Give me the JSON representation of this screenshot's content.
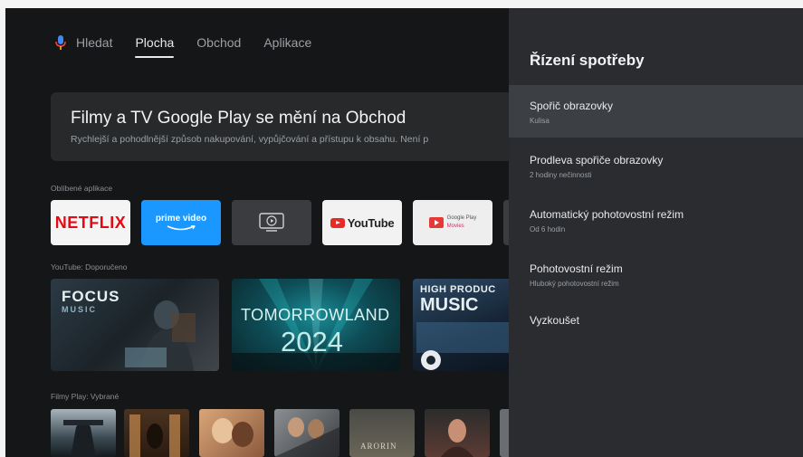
{
  "nav": {
    "search_label": "Hledat",
    "tabs": [
      {
        "label": "Plocha",
        "active": true
      },
      {
        "label": "Obchod",
        "active": false
      },
      {
        "label": "Aplikace",
        "active": false
      }
    ]
  },
  "banner": {
    "title": "Filmy a TV Google Play se mění na Obchod",
    "subtitle": "Rychlejší a pohodlnější způsob nakupování, vypůjčování a přístupu k obsahu. Není p"
  },
  "favorite_apps": {
    "label": "Oblíbené aplikace",
    "apps": [
      {
        "name": "Netflix",
        "text": "NETFLIX",
        "color": "#e50914"
      },
      {
        "name": "Prime Video",
        "text": "prime video",
        "color": "#1a98ff"
      },
      {
        "name": "Live TV",
        "icon": "tv-play-icon"
      },
      {
        "name": "YouTube",
        "text": "YouTube",
        "color": "#e52d27"
      },
      {
        "name": "Google Play Movies",
        "text_line1": "Google Play",
        "text_line2": "Movies",
        "color": "#e91e63"
      }
    ]
  },
  "youtube_recommended": {
    "label": "YouTube: Doporučeno",
    "videos": [
      {
        "title_line1": "FOCUS",
        "title_line2": "MUSIC"
      },
      {
        "title_line1": "TOMORROWLAND",
        "title_line2": "2024"
      },
      {
        "title_line1": "HIGH PRODUC",
        "title_line2": "MUSIC"
      }
    ]
  },
  "play_movies": {
    "label": "Filmy Play: Vybrané",
    "movies": [
      {
        "poster_text": ""
      },
      {
        "poster_text": ""
      },
      {
        "poster_text": ""
      },
      {
        "poster_text": ""
      },
      {
        "poster_text": "ARORIN"
      },
      {
        "poster_text": ""
      },
      {
        "poster_text": ""
      }
    ]
  },
  "settings_panel": {
    "title": "Řízení spotřeby",
    "items": [
      {
        "label": "Spořič obrazovky",
        "value": "Kulisa",
        "focused": true
      },
      {
        "label": "Prodleva spořiče obrazovky",
        "value": "2 hodiny nečinnosti",
        "focused": false
      },
      {
        "label": "Automatický pohotovostní režim",
        "value": "Od 6 hodin",
        "focused": false
      },
      {
        "label": "Pohotovostní režim",
        "value": "Hluboký pohotovostní režim",
        "focused": false
      },
      {
        "label": "Vyzkoušet",
        "value": "",
        "focused": false
      }
    ]
  },
  "colors": {
    "background": "#151617",
    "panel": "#2a2c2f",
    "focused_item": "#3c3f43",
    "mic_accent": "#4285f4"
  }
}
